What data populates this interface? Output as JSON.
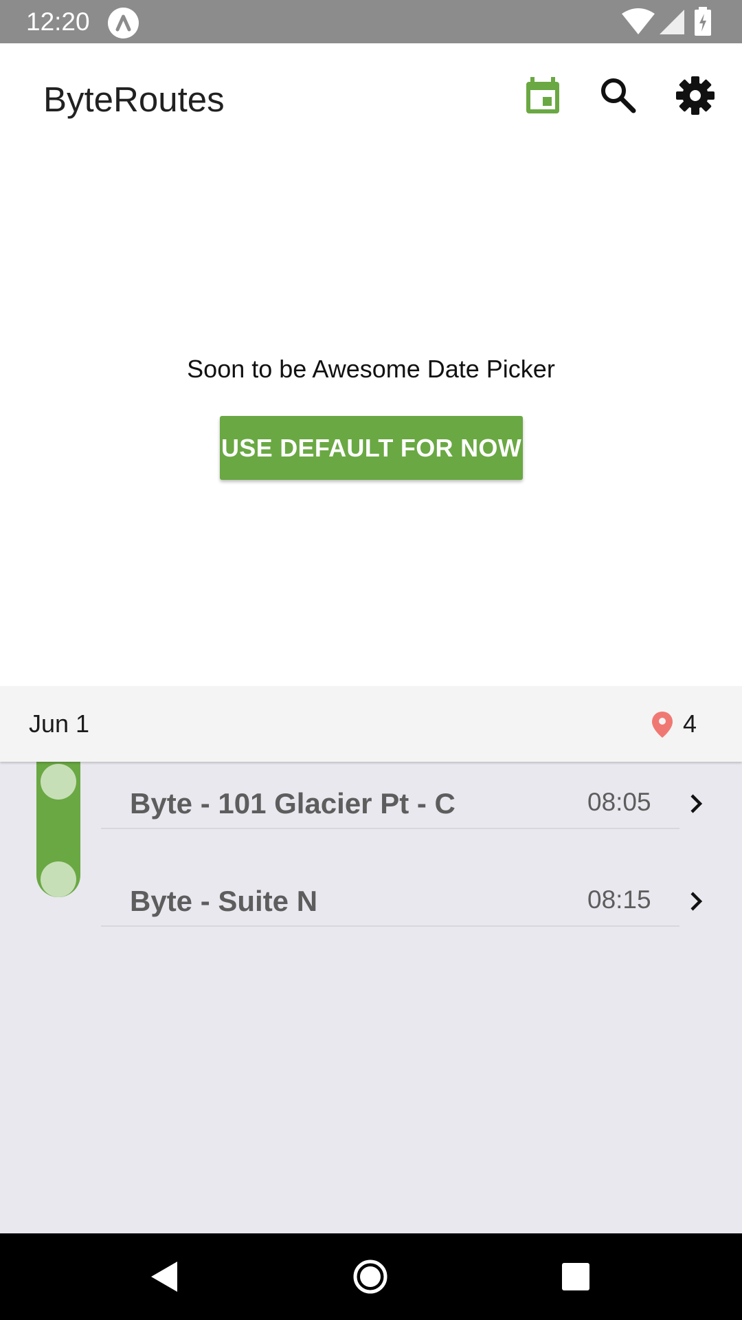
{
  "status_bar": {
    "time": "12:20",
    "icons": [
      "app-notification-icon",
      "wifi-icon",
      "signal-icon",
      "battery-icon"
    ]
  },
  "app_bar": {
    "title": "ByteRoutes",
    "actions": [
      "calendar-icon",
      "search-icon",
      "settings-icon"
    ],
    "accent_color": "#6aa843"
  },
  "picker": {
    "message": "Soon to be Awesome Date Picker",
    "button_label": "USE DEFAULT FOR NOW"
  },
  "day": {
    "label": "Jun 1",
    "stop_count": "4",
    "pin_color": "#f07873"
  },
  "routes": [
    {
      "name": "Byte - 101 Glacier Pt - C",
      "time": "08:05"
    },
    {
      "name": "Byte - Suite N",
      "time": "08:15"
    }
  ],
  "nav_bar": {
    "buttons": [
      "back-icon",
      "home-icon",
      "recents-icon"
    ]
  }
}
